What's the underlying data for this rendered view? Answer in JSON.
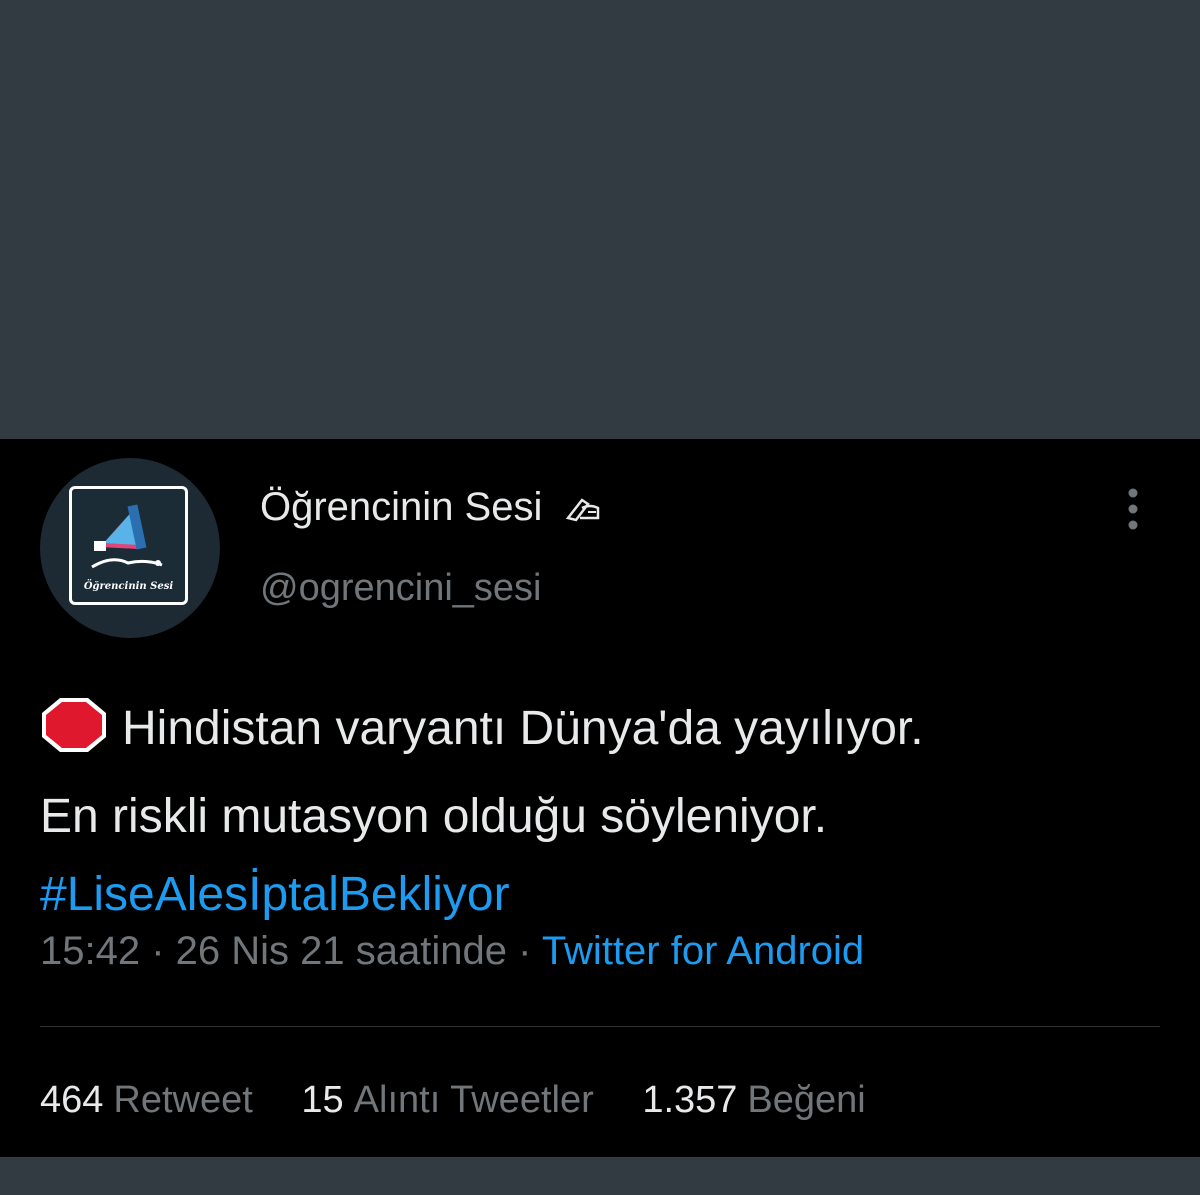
{
  "tweet": {
    "author": {
      "display_name": "Öğrencinin Sesi",
      "name_emoji": "writing-hand-icon",
      "handle": "@ogrencini_sesi",
      "avatar_label": "Öğrencinin Sesi"
    },
    "text": {
      "emoji": "stop-sign-icon",
      "line1": "Hindistan varyantı Dünya'da yayılıyor.",
      "line2": "En riskli mutasyon olduğu söyleniyor.",
      "hashtag": "#LiseAlesİptalBekliyor"
    },
    "meta": {
      "time": "15:42",
      "separator": " · ",
      "date": "26 Nis 21 saatinde",
      "source": "Twitter for Android"
    },
    "stats": {
      "retweets": {
        "count": "464",
        "label": "Retweet"
      },
      "quotes": {
        "count": "15",
        "label": "Alıntı Tweetler"
      },
      "likes": {
        "count": "1.357",
        "label": "Beğeni"
      }
    }
  },
  "colors": {
    "background": "#000000",
    "frame": "#323b42",
    "text_primary": "#e7e9ea",
    "text_secondary": "#71767b",
    "accent": "#1d9bf0",
    "stop_red": "#e0182d"
  }
}
